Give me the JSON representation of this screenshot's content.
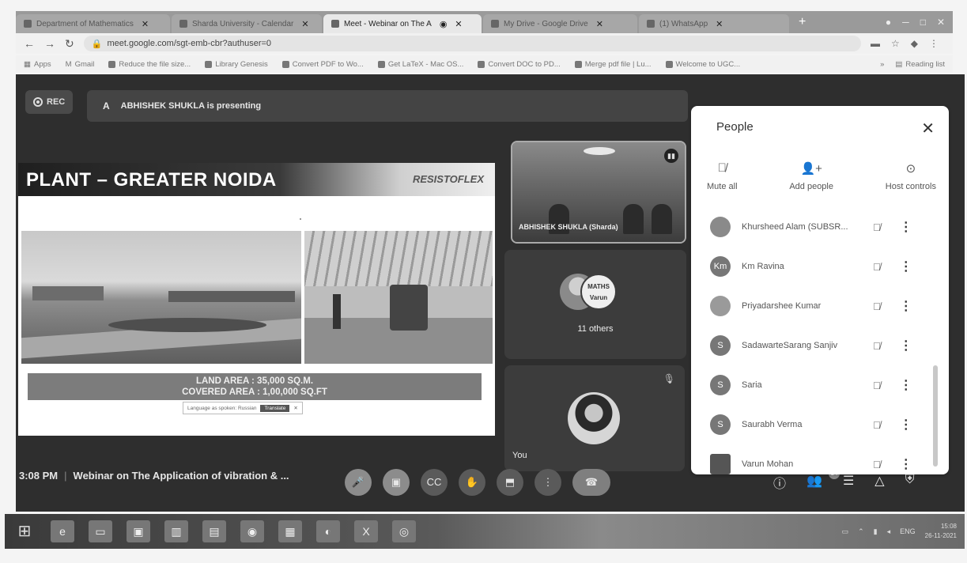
{
  "browser": {
    "tabs": [
      {
        "label": "Department of Mathematics",
        "active": false
      },
      {
        "label": "Sharda University - Calendar",
        "active": false
      },
      {
        "label": "Meet - Webinar on The A",
        "active": true
      },
      {
        "label": "My Drive - Google Drive",
        "active": false
      },
      {
        "label": "(1) WhatsApp",
        "active": false
      }
    ],
    "new_tab": "+",
    "url": "meet.google.com/sgt-emb-cbr?authuser=0",
    "bookmarks": [
      "Apps",
      "Gmail",
      "Reduce the file size...",
      "Library Genesis",
      "Convert PDF to Wo...",
      "Get LaTeX - Mac OS...",
      "Convert DOC to PD...",
      "Merge pdf file | Lu...",
      "Welcome to UGC..."
    ],
    "reading_list": "Reading list"
  },
  "meet": {
    "rec_label": "REC",
    "presenter_avatar": "A",
    "presenting_text": "ABHISHEK SHUKLA is presenting",
    "slide": {
      "title": "PLANT – GREATER NOIDA",
      "logo": "RESISTOFLEX",
      "land_area": "LAND AREA : 35,000 SQ.M.",
      "covered_area": "COVERED AREA : 1,00,000 SQ.FT",
      "translate_text": "Language as spoken: Russian",
      "translate_button": "Translate",
      "translate_close": "✕"
    },
    "tiles": {
      "presenter_name": "ABHISHEK SHUKLA (Sharda)",
      "others_avatar_text": "MATHS Varun",
      "others_label": "11 others",
      "self_label": "You"
    },
    "meeting_time": "3:08 PM",
    "meeting_title": "Webinar on The Application of vibration & ...",
    "participant_count": "14"
  },
  "people_panel": {
    "title": "People",
    "actions": [
      {
        "label": "Mute all",
        "icon": "mic-off-icon"
      },
      {
        "label": "Add people",
        "icon": "add-person-icon"
      },
      {
        "label": "Host controls",
        "icon": "toggle-icon"
      }
    ],
    "participants": [
      {
        "initials": "",
        "name": "Khursheed Alam (SUBSR..."
      },
      {
        "initials": "Km",
        "name": "Km Ravina"
      },
      {
        "initials": "",
        "name": "Priyadarshee Kumar"
      },
      {
        "initials": "S",
        "name": "SadawarteSarang Sanjiv"
      },
      {
        "initials": "S",
        "name": "Saria"
      },
      {
        "initials": "S",
        "name": "Saurabh Verma"
      },
      {
        "initials": "",
        "name": "Varun Mohan"
      }
    ]
  },
  "taskbar": {
    "tray_lang": "ENG",
    "clock_time": "15:08",
    "clock_date": "26-11-2021"
  }
}
